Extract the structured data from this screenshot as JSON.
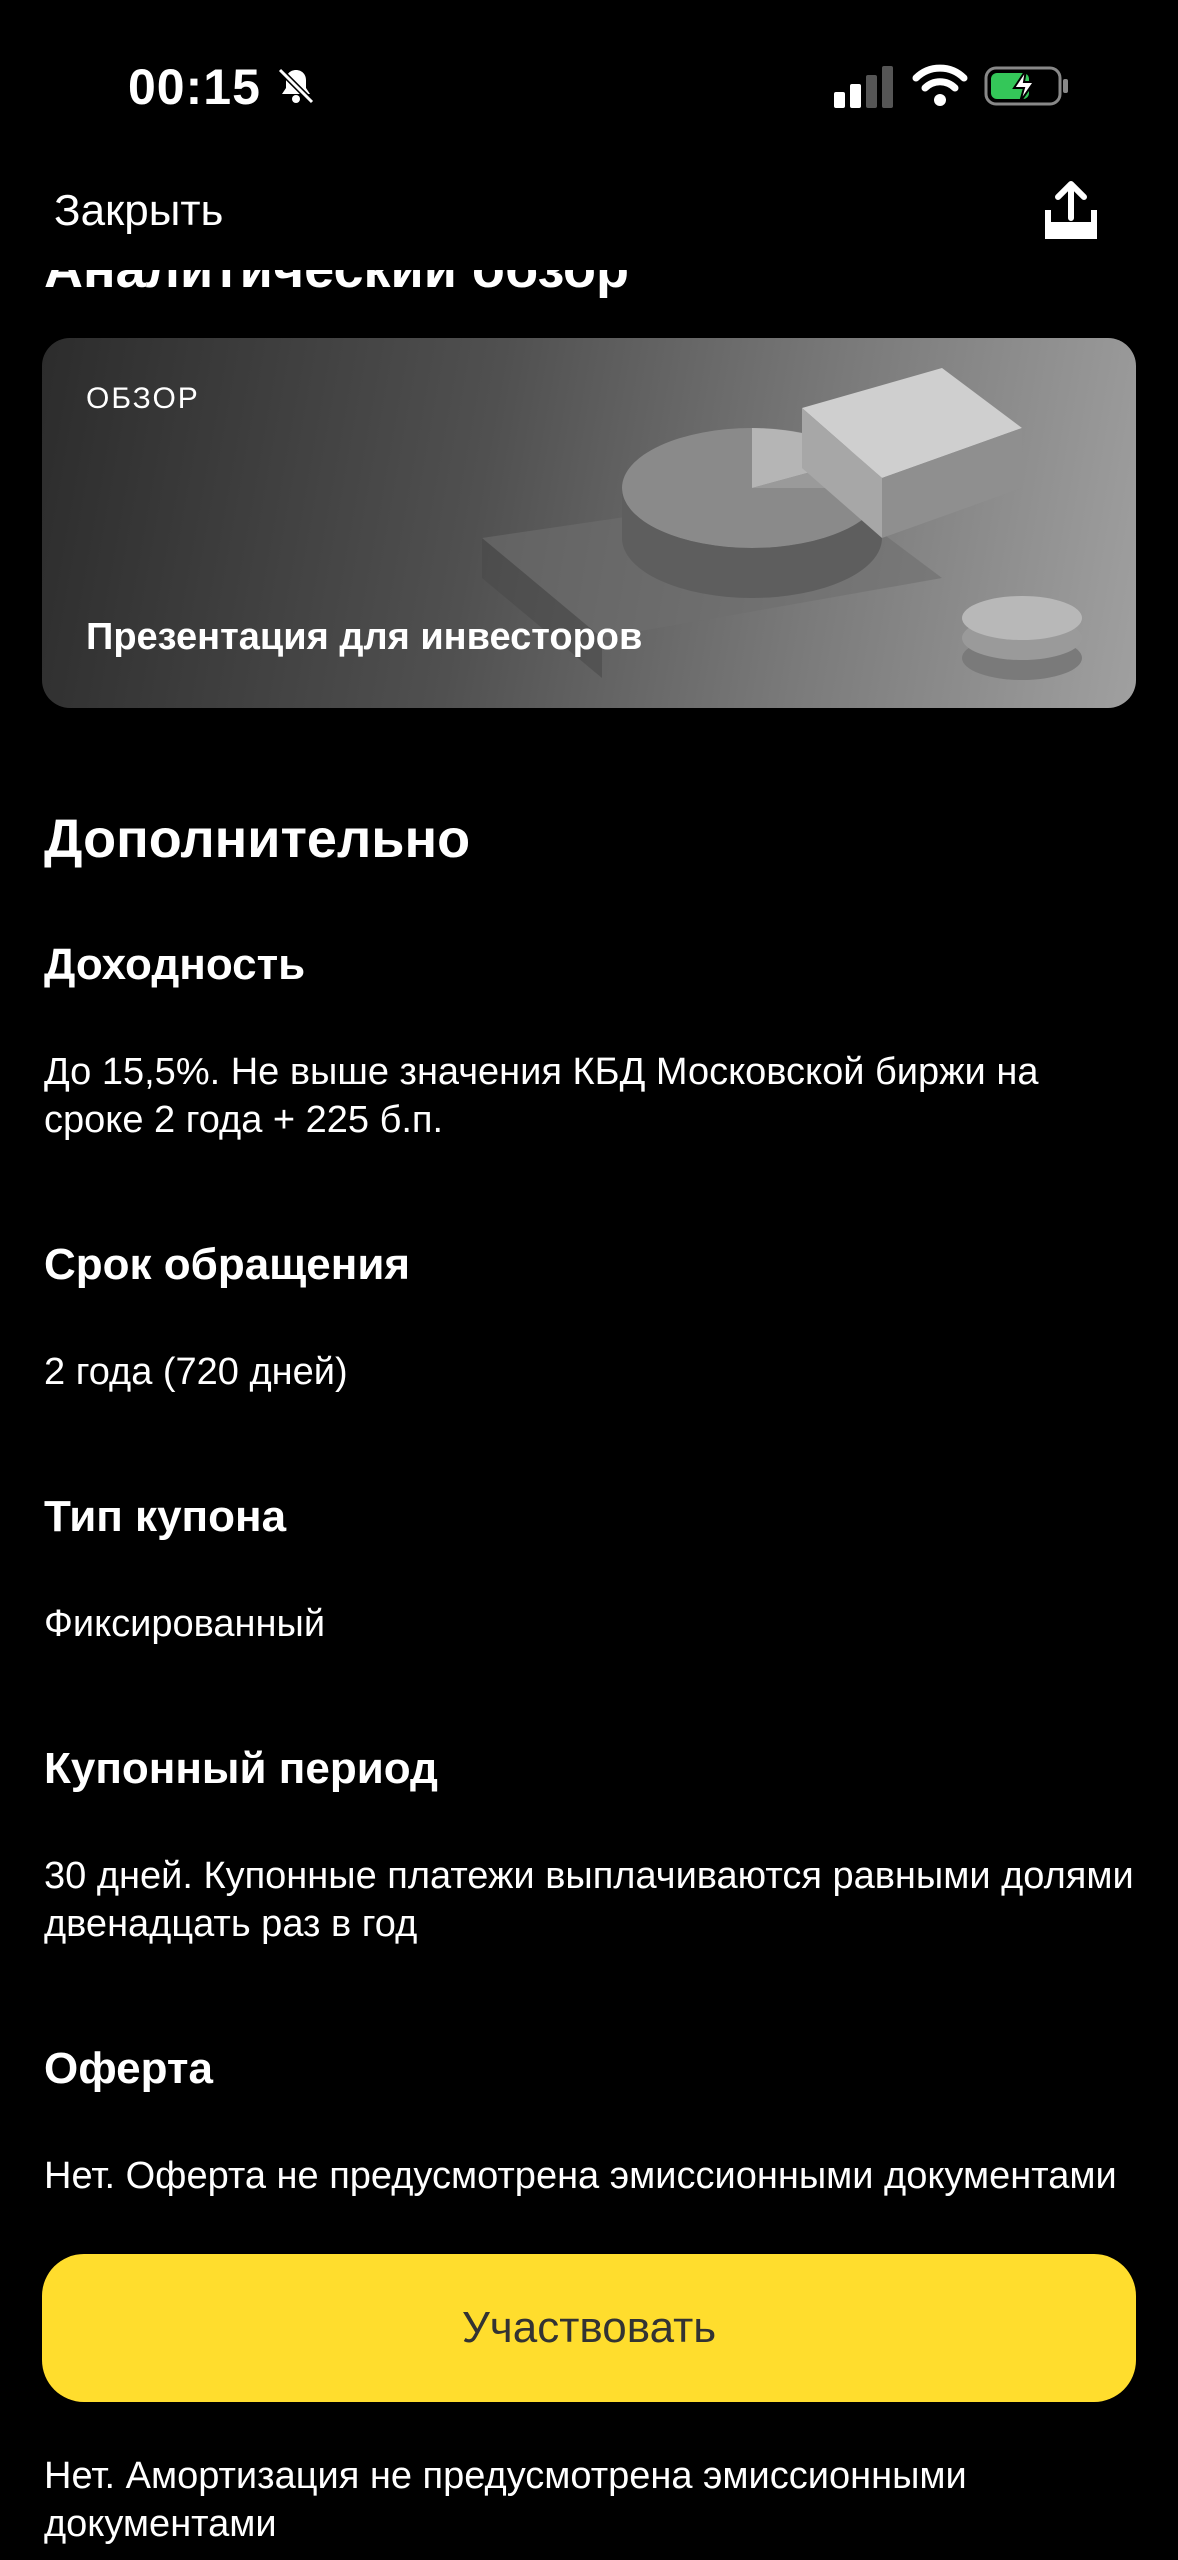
{
  "status_bar": {
    "time": "00:15"
  },
  "nav": {
    "close_label": "Закрыть"
  },
  "analytics": {
    "heading": "Аналитический обзор",
    "card": {
      "tag": "ОБЗОР",
      "title": "Презентация для инвесторов"
    }
  },
  "additional": {
    "heading": "Дополнительно",
    "items": [
      {
        "title": "Доходность",
        "text": "До 15,5%. Не выше значения КБД Московской биржи на сроке 2 года + 225 б.п."
      },
      {
        "title": "Срок обращения",
        "text": "2 года (720 дней)"
      },
      {
        "title": "Тип купона",
        "text": "Фиксированный"
      },
      {
        "title": "Купонный период",
        "text": "30 дней. Купонные платежи выплачиваются равными долями двенадцать раз в год"
      },
      {
        "title": "Оферта",
        "text": "Нет. Оферта не предусмотрена эмиссионными документами"
      },
      {
        "title": "",
        "text": "Нет. Амортизация не предусмотрена эмиссионными документами"
      }
    ]
  },
  "cta": {
    "label": "Участвовать"
  },
  "colors": {
    "accent": "#ffdd2d",
    "background": "#000000",
    "battery_green": "#34c759"
  }
}
